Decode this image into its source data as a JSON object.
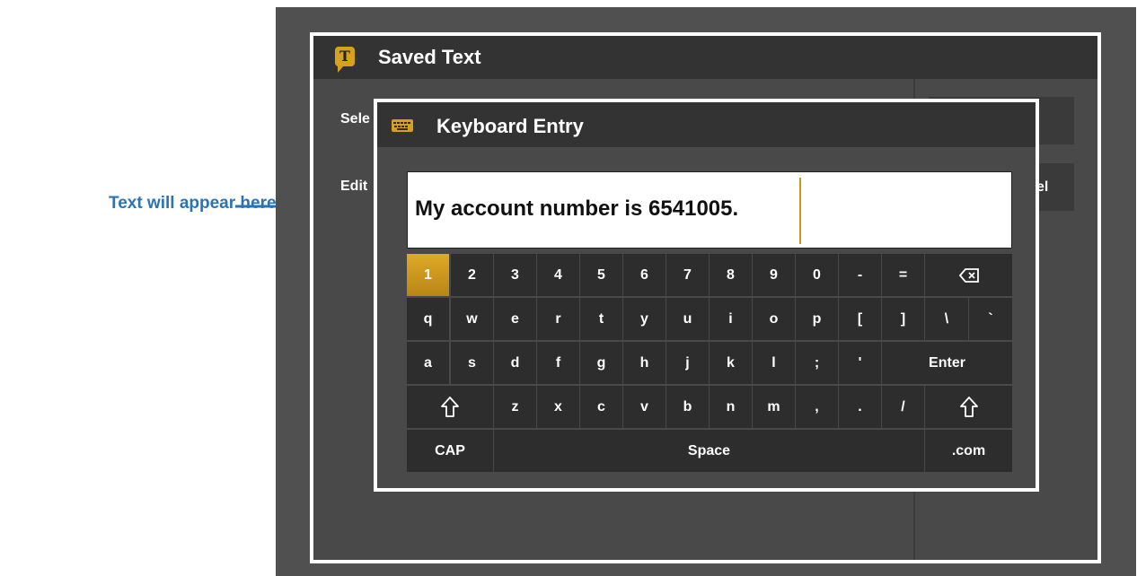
{
  "annotation": {
    "text": "Text will appear here"
  },
  "saved_text": {
    "title": "Saved Text",
    "logo_letter": "T",
    "labels": [
      "Sele",
      "Edit"
    ],
    "right_buttons": [
      "",
      "el"
    ]
  },
  "keyboard_dialog": {
    "title": "Keyboard Entry",
    "icon": "keyboard-icon",
    "text_value": "My account number is 6541005.",
    "active_key": "1"
  },
  "keyboard": {
    "row1": [
      "1",
      "2",
      "3",
      "4",
      "5",
      "6",
      "7",
      "8",
      "9",
      "0",
      "-",
      "="
    ],
    "row2": [
      "q",
      "w",
      "e",
      "r",
      "t",
      "y",
      "u",
      "i",
      "o",
      "p",
      "[",
      "]",
      "\\",
      "`"
    ],
    "row3": [
      "a",
      "s",
      "d",
      "f",
      "g",
      "h",
      "j",
      "k",
      "l",
      ";",
      "'"
    ],
    "row3_enter": "Enter",
    "row4": [
      "z",
      "x",
      "c",
      "v",
      "b",
      "n",
      "m",
      ",",
      ".",
      "/"
    ],
    "row5": {
      "cap": "CAP",
      "space": "Space",
      "dotcom": ".com"
    },
    "icons": {
      "backspace": "backspace-icon",
      "shift": "shift-icon"
    }
  },
  "colors": {
    "accent": "#d4a21d",
    "annotation": "#2a74b5",
    "background": "#505050"
  }
}
